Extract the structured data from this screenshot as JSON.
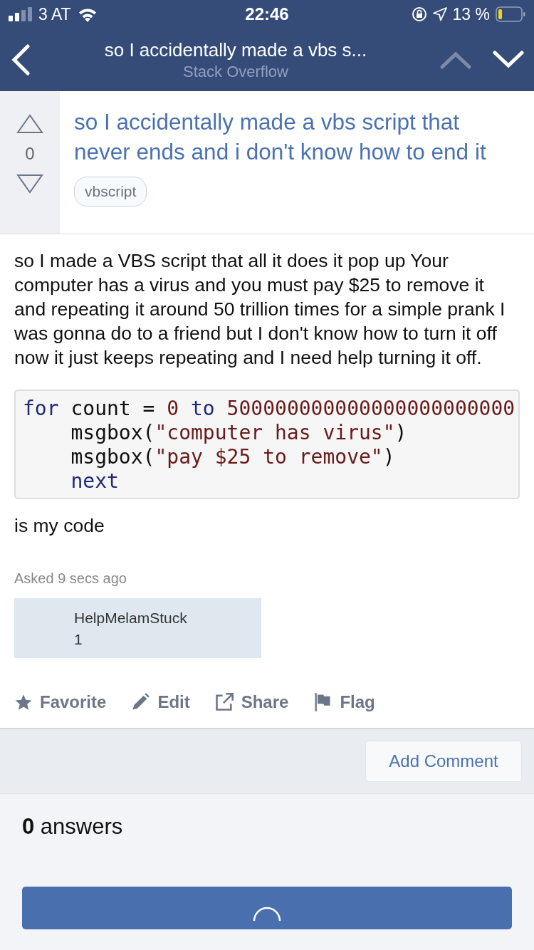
{
  "status_bar": {
    "carrier": "3 AT",
    "time": "22:46",
    "battery": "13 %"
  },
  "nav": {
    "title": "so I accidentally made a vbs s...",
    "subtitle": "Stack Overflow",
    "up_disabled": true,
    "down_disabled": false
  },
  "question": {
    "votes": "0",
    "title": "so I accidentally made a vbs script that never ends and i don't know how to end it",
    "tags": [
      "vbscript"
    ],
    "body": "so I made a VBS script that all it does it pop up Your computer has a virus and you must pay $25 to remove it and repeating it around 50 trillion times for a simple prank I was gonna do to a friend but I don't know how to turn it off now it just keeps repeating and I need help turning it off.",
    "code": [
      {
        "indent": false,
        "tokens": [
          {
            "kind": "keyword",
            "text": "for"
          },
          {
            "kind": "plain",
            "text": " count = "
          },
          {
            "kind": "literal",
            "text": "0"
          },
          {
            "kind": "keyword",
            "text": " to "
          },
          {
            "kind": "literal",
            "text": "500000000000000000000000"
          }
        ]
      },
      {
        "indent": true,
        "tokens": [
          {
            "kind": "plain",
            "text": "msgbox("
          },
          {
            "kind": "literal",
            "text": "\"computer has virus\""
          },
          {
            "kind": "plain",
            "text": ")"
          }
        ]
      },
      {
        "indent": true,
        "tokens": [
          {
            "kind": "plain",
            "text": "msgbox("
          },
          {
            "kind": "literal",
            "text": "\"pay $25 to remove\""
          },
          {
            "kind": "plain",
            "text": ")"
          }
        ]
      },
      {
        "indent": true,
        "tokens": [
          {
            "kind": "keyword",
            "text": "next"
          }
        ]
      }
    ],
    "after_code": "is my code",
    "asked": "Asked 9 secs ago",
    "author": {
      "name": "HelpMelamStuck",
      "reputation": "1"
    },
    "actions": [
      {
        "kind": "favorite",
        "label": "Favorite"
      },
      {
        "kind": "edit",
        "label": "Edit"
      },
      {
        "kind": "share",
        "label": "Share"
      },
      {
        "kind": "flag",
        "label": "Flag"
      }
    ]
  },
  "add_comment": "Add Comment",
  "answers_heading": "**0** answers"
}
